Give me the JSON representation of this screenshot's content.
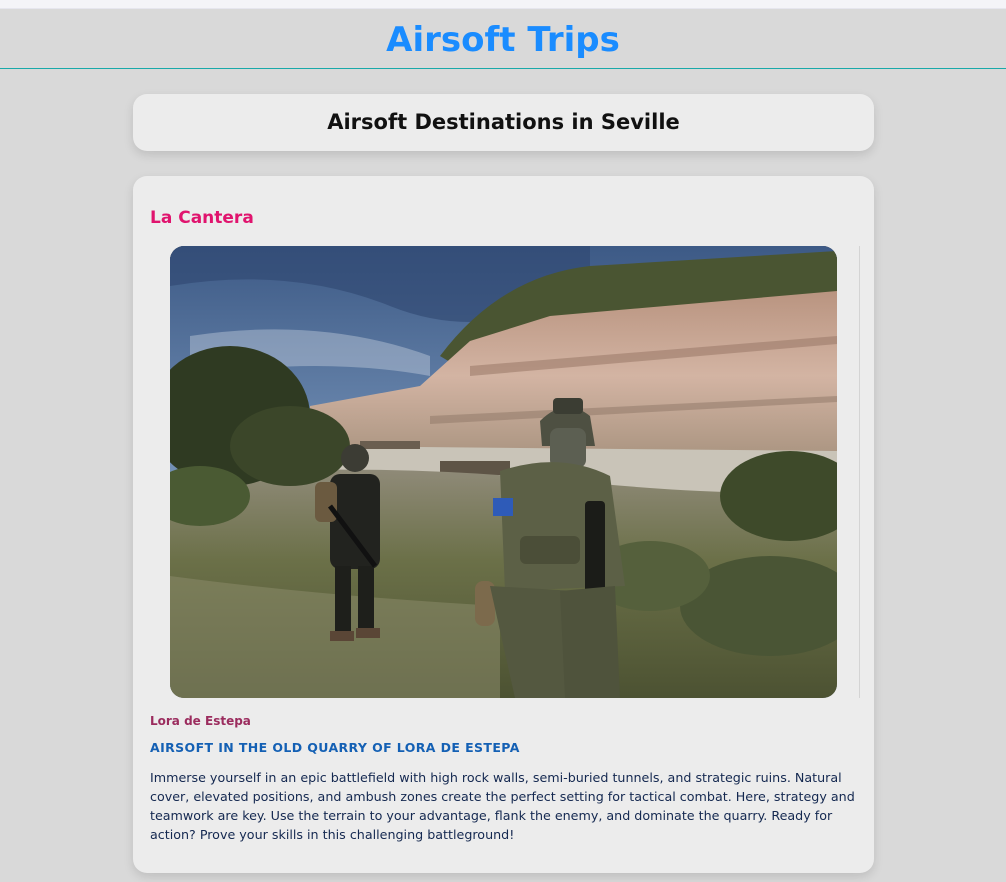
{
  "site": {
    "title": "Airsoft Trips"
  },
  "section": {
    "title": "Airsoft Destinations in Seville"
  },
  "destination": {
    "name": "La Cantera",
    "image_subject": "Two airsoft players in camouflage gear with helmets and replica rifles walking through scrubland below a rocky quarry cliff",
    "location": "Lora de Estepa",
    "subtitle": "AIRSOFT IN THE OLD QUARRY OF LORA DE ESTEPA",
    "description": "Immerse yourself in an epic battlefield with high rock walls, semi-buried tunnels, and strategic ruins. Natural cover, elevated positions, and ambush zones create the perfect setting for tactical combat. Here, strategy and teamwork are key. Use the terrain to your advantage, flank the enemy, and dominate the quarry. Ready for action? Prove your skills in this challenging battleground!"
  },
  "colors": {
    "title_accent": "#1a8cff",
    "destination_name": "#e0146e",
    "location": "#9b2c5e",
    "subtitle": "#1460b4",
    "header_rule": "#1aa9a9",
    "page_background": "#d9d9d9",
    "card_background": "#ececec"
  }
}
